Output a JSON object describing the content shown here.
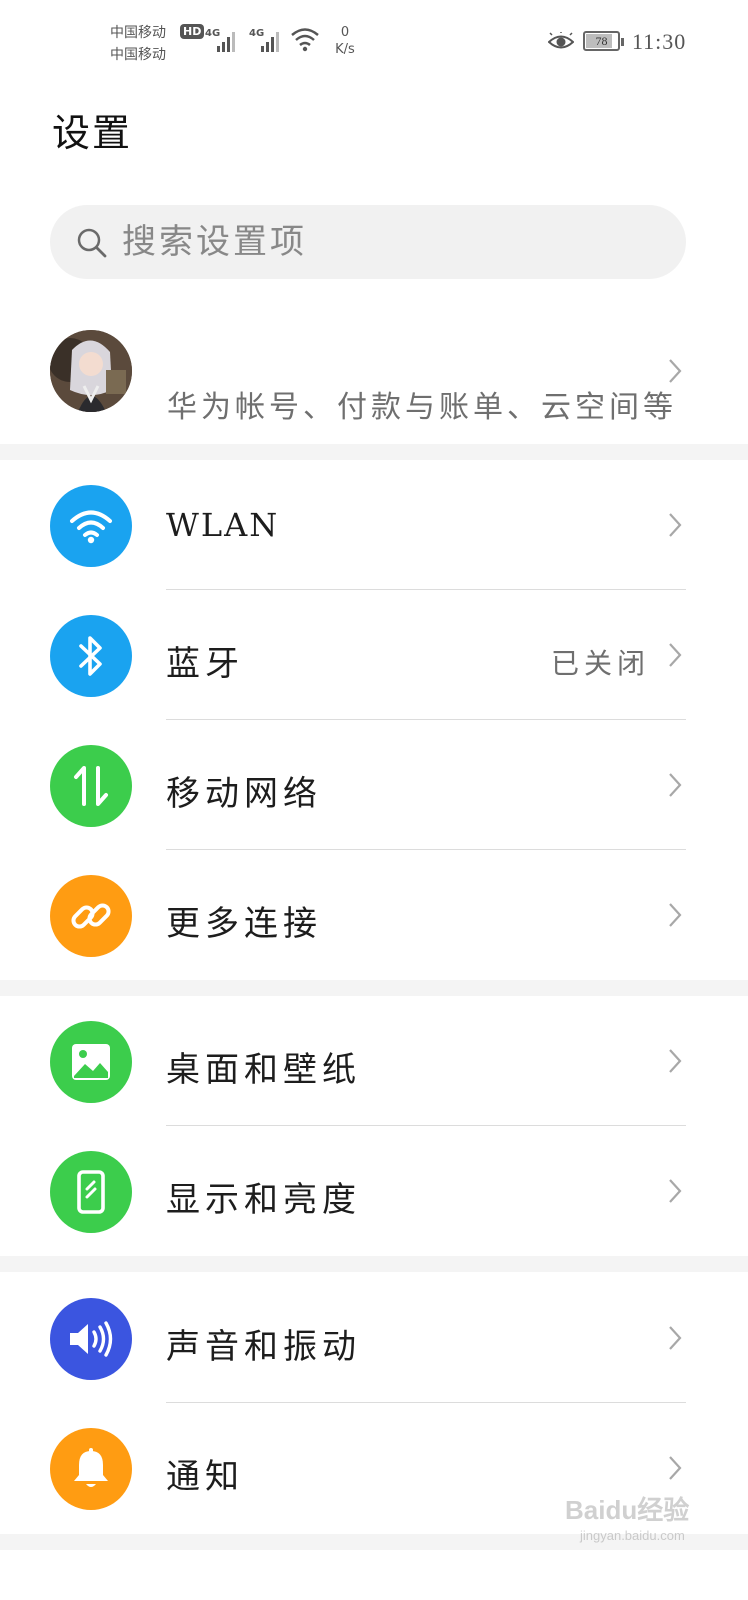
{
  "status_bar": {
    "carrier_1": "中国移动",
    "carrier_2": "中国移动",
    "hd_badge": "HD",
    "network_1": "4G",
    "network_2": "4G",
    "speed_value": "0",
    "speed_unit": "K/s",
    "battery_level": "78",
    "time": "11:30",
    "icons": [
      "signal-icon",
      "wifi-icon",
      "eye-comfort-icon",
      "battery-icon"
    ]
  },
  "page": {
    "title": "设置"
  },
  "search": {
    "placeholder": "搜索设置项",
    "icon": "search-icon"
  },
  "account": {
    "subtitle": "华为帐号、付款与账单、云空间等"
  },
  "sections": [
    {
      "items": [
        {
          "label": "WLAN",
          "icon": "wifi-icon",
          "color": "#1aa3f0"
        },
        {
          "label": "蓝牙",
          "value": "已关闭",
          "icon": "bluetooth-icon",
          "color": "#1aa3f0"
        },
        {
          "label": "移动网络",
          "icon": "mobile-data-icon",
          "color": "#3ccd4c"
        },
        {
          "label": "更多连接",
          "icon": "link-icon",
          "color": "#ff9c12"
        }
      ]
    },
    {
      "items": [
        {
          "label": "桌面和壁纸",
          "icon": "wallpaper-icon",
          "color": "#3ccd4c"
        },
        {
          "label": "显示和亮度",
          "icon": "display-icon",
          "color": "#3ccd4c"
        }
      ]
    },
    {
      "items": [
        {
          "label": "声音和振动",
          "icon": "sound-icon",
          "color": "#3b55e0"
        },
        {
          "label": "通知",
          "icon": "bell-icon",
          "color": "#ff9c12"
        }
      ]
    }
  ],
  "watermark": {
    "brand": "Baidu经验",
    "url": "jingyan.baidu.com"
  }
}
